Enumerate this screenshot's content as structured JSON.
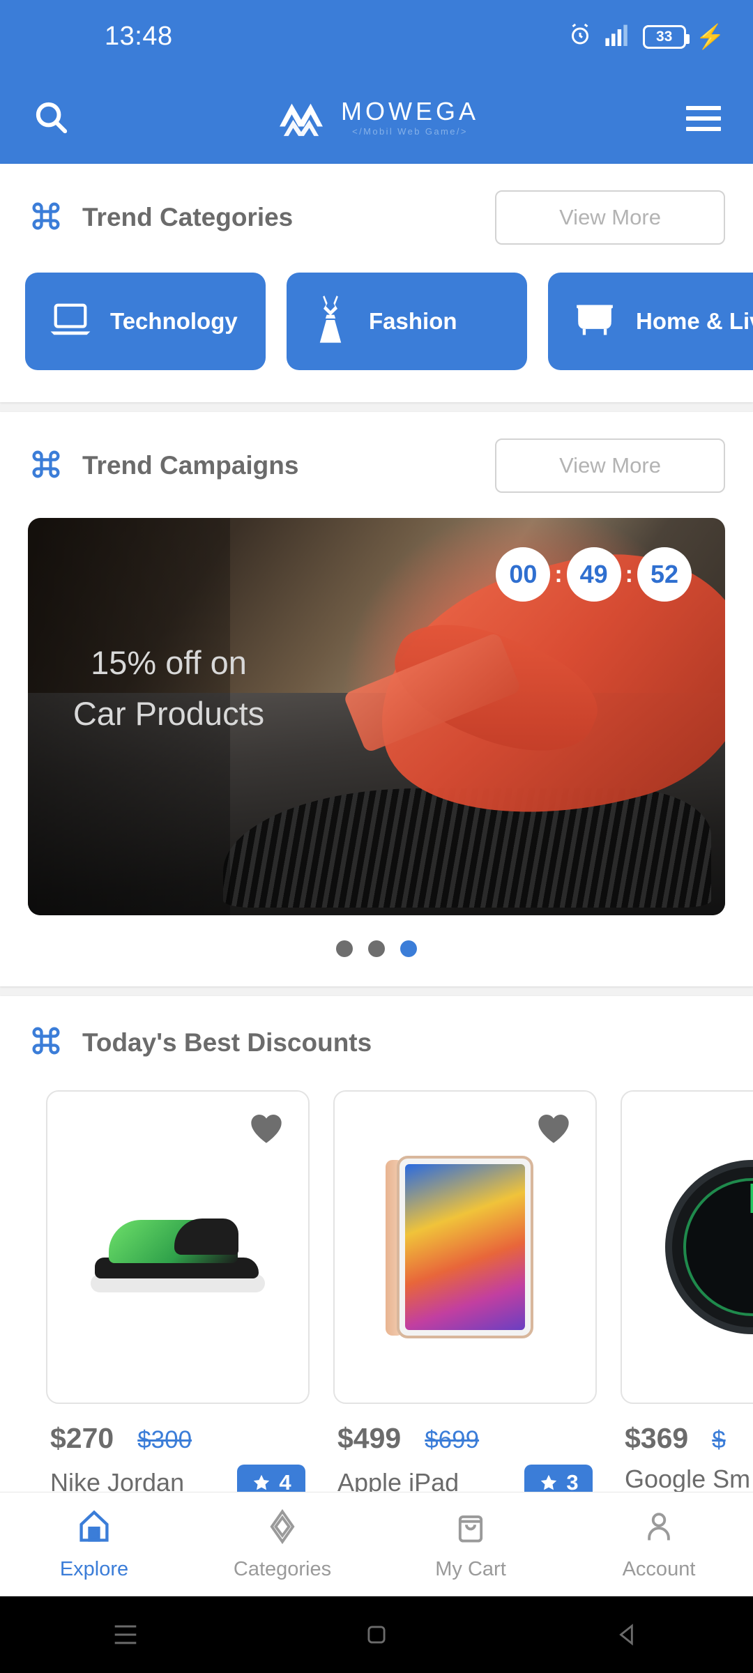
{
  "status_bar": {
    "time": "13:48",
    "battery_percent": "33",
    "icons": [
      "alarm-icon",
      "signal-icon",
      "battery-icon",
      "charging-bolt-icon"
    ]
  },
  "app_header": {
    "search_icon": "search-icon",
    "brand_name": "MOWEGA",
    "brand_subtitle": "</Mobil Web Game/>",
    "menu_icon": "hamburger-menu-icon"
  },
  "theme": {
    "primary": "#3b7dd8",
    "text_gray": "#6b6b6b",
    "muted": "#b3b3b3",
    "accent_green": "#2ed15b"
  },
  "trend_categories": {
    "title": "Trend Categories",
    "view_more_label": "View More",
    "items": [
      {
        "label": "Technology",
        "icon": "laptop-icon"
      },
      {
        "label": "Fashion",
        "icon": "dress-icon"
      },
      {
        "label": "Home & Living",
        "icon": "armchair-icon"
      }
    ]
  },
  "trend_campaigns": {
    "title": "Trend Campaigns",
    "view_more_label": "View More",
    "banner": {
      "headline": "15% off on Car Products",
      "countdown": {
        "hours": "00",
        "minutes": "49",
        "seconds": "52",
        "separator": ":"
      }
    },
    "carousel": {
      "total_dots": 3,
      "active_index": 2
    }
  },
  "best_discounts": {
    "title": "Today's Best Discounts",
    "products": [
      {
        "name": "Nike Jordan",
        "price": "$270",
        "old_price": "$300",
        "rating": "4",
        "favorite_icon": "heart-icon",
        "image": "sneaker-image"
      },
      {
        "name": "Apple iPad",
        "price": "$499",
        "old_price": "$699",
        "rating": "3",
        "favorite_icon": "heart-icon",
        "image": "tablet-image"
      },
      {
        "name": "Google Sm",
        "price": "$369",
        "old_price": "$",
        "rating": "",
        "favorite_icon": "heart-icon",
        "image": "smartwatch-image"
      }
    ]
  },
  "bottom_nav": {
    "items": [
      {
        "label": "Explore",
        "icon": "home-icon",
        "active": true
      },
      {
        "label": "Categories",
        "icon": "diamond-icon",
        "active": false
      },
      {
        "label": "My Cart",
        "icon": "shopping-bag-icon",
        "active": false
      },
      {
        "label": "Account",
        "icon": "person-icon",
        "active": false
      }
    ]
  },
  "android_nav": {
    "recents_icon": "recents-icon",
    "home_icon": "home-square-icon",
    "back_icon": "back-triangle-icon"
  }
}
